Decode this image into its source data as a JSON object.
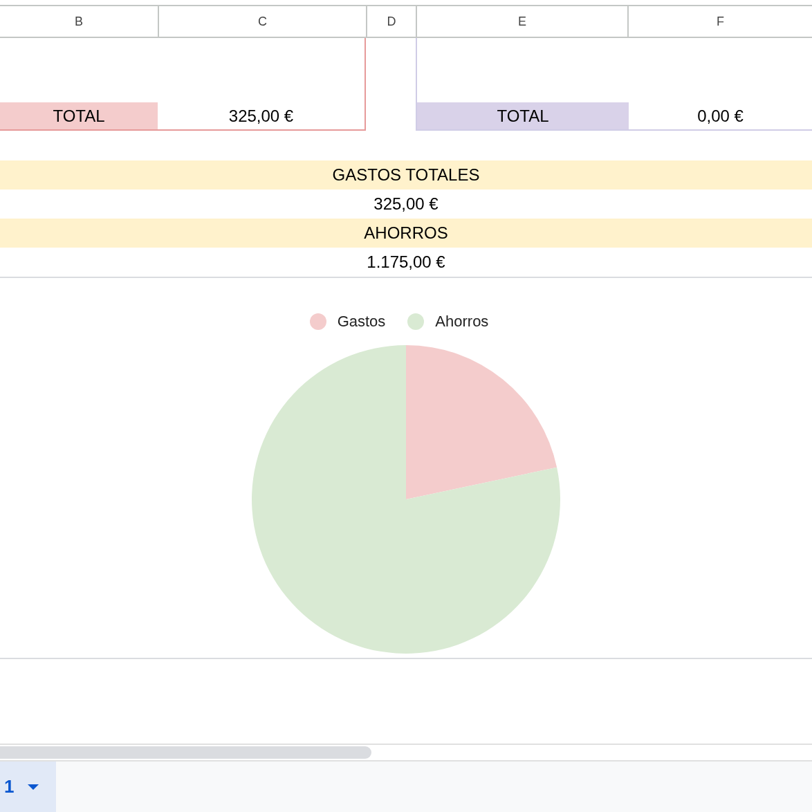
{
  "columns": [
    "B",
    "C",
    "D",
    "E",
    "F"
  ],
  "totals": [
    {
      "label": "TOTAL",
      "value": "325,00 €",
      "color": "#f4cccc"
    },
    {
      "label": "TOTAL",
      "value": "0,00 €",
      "color": "#d9d2e9"
    }
  ],
  "summary": [
    {
      "label": "GASTOS TOTALES",
      "value": "325,00 €"
    },
    {
      "label": "AHORROS",
      "value": "1.175,00 €"
    }
  ],
  "chart_data": {
    "type": "pie",
    "categories": [
      "Gastos",
      "Ahorros"
    ],
    "values": [
      21.67,
      78.33
    ],
    "colors": [
      "#f4cccc",
      "#d9ead3"
    ],
    "legend": "top"
  },
  "sheet_tabs": [
    {
      "label": "1",
      "selected": true
    }
  ]
}
